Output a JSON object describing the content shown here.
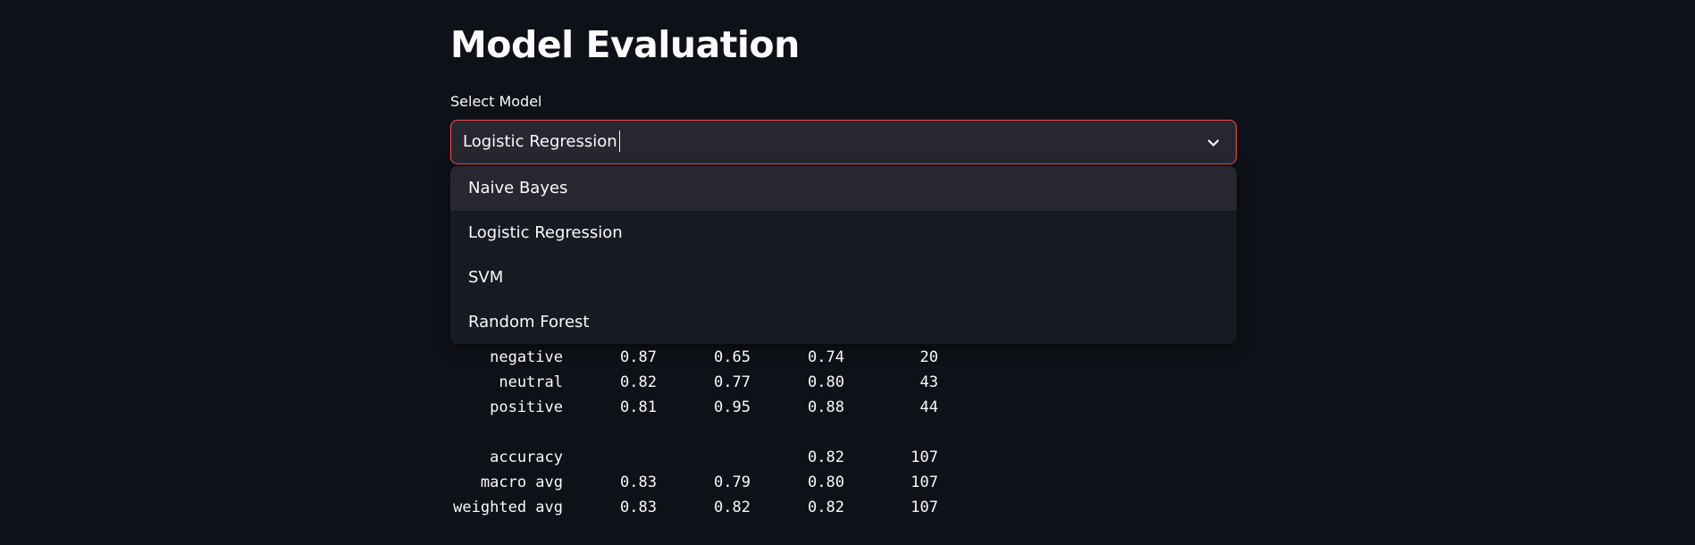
{
  "page": {
    "title": "Model Evaluation"
  },
  "select": {
    "label": "Select Model",
    "current_value": "Logistic Regression",
    "options": [
      "Naive Bayes",
      "Logistic Regression",
      "SVM",
      "Random Forest"
    ]
  },
  "report": {
    "rows": [
      {
        "label": "negative",
        "precision": "0.87",
        "recall": "0.65",
        "f1": "0.74",
        "support": "20"
      },
      {
        "label": "neutral",
        "precision": "0.82",
        "recall": "0.77",
        "f1": "0.80",
        "support": "43"
      },
      {
        "label": "positive",
        "precision": "0.81",
        "recall": "0.95",
        "f1": "0.88",
        "support": "44"
      },
      {
        "label": "accuracy",
        "precision": "",
        "recall": "",
        "f1": "0.82",
        "support": "107"
      },
      {
        "label": "macro avg",
        "precision": "0.83",
        "recall": "0.79",
        "f1": "0.80",
        "support": "107"
      },
      {
        "label": "weighted avg",
        "precision": "0.83",
        "recall": "0.82",
        "f1": "0.82",
        "support": "107"
      }
    ]
  },
  "colors": {
    "background": "#0e1117",
    "input_background": "#262730",
    "focus_border": "#ff4b4b",
    "dropdown_background": "#161a22",
    "text": "#fafafa"
  },
  "icons": {
    "select_chevron": "chevron-down-icon"
  }
}
